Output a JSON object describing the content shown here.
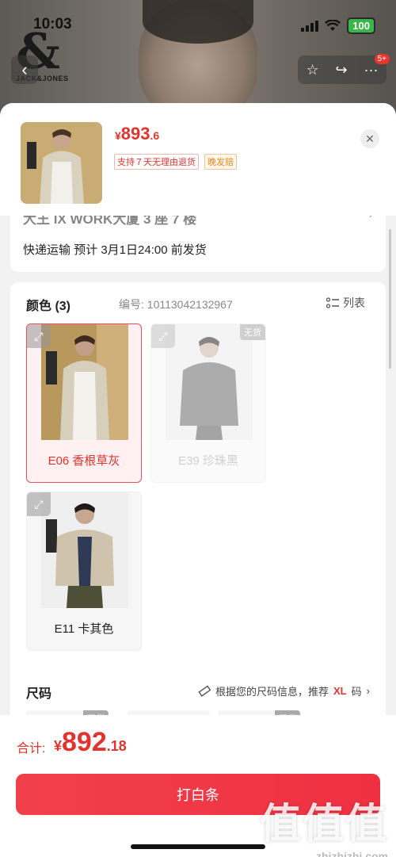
{
  "status_bar": {
    "time": "10:03",
    "battery": "100"
  },
  "brand": {
    "mark": "&",
    "name": "JACK&JONES"
  },
  "nav": {
    "badge": "5+"
  },
  "sheet": {
    "price": {
      "currency": "¥",
      "integer": "893",
      "decimal": ".6"
    },
    "tag_return": "支持７天无理由退货",
    "tag_late": "晚发赔"
  },
  "shipping": {
    "address": "大王 IX WORK大厦 3 座 7 楼",
    "info": "快递运输 预计 3月1日24:00 前发货"
  },
  "color_section": {
    "title": "颜色 (3)",
    "code": "编号: 10113042132967",
    "list_toggle": "列表",
    "variants": [
      {
        "label": "E06 香根草灰",
        "state": "selected",
        "sold_out": ""
      },
      {
        "label": "E39 珍珠黑",
        "state": "sold-out",
        "sold_out": "无货"
      },
      {
        "label": "E11 卡其色",
        "state": "available",
        "sold_out": ""
      }
    ]
  },
  "size_section": {
    "title": "尺码",
    "rec_prefix": "根据您的尺码信息，推荐",
    "rec_size": "XL",
    "rec_suffix": "码",
    "chips": [
      {
        "sold_out": "无货"
      },
      {
        "sold_out": ""
      },
      {
        "sold_out": "无货"
      }
    ]
  },
  "bottom": {
    "total_label": "合计:",
    "total": {
      "currency": "¥",
      "integer": "892",
      "decimal": ".18"
    },
    "buy_button": "打白条"
  },
  "watermark": {
    "main": "值值值",
    "sub": "zhizhizhi.com"
  },
  "colors": {
    "accent": "#e3332c",
    "button": "#f0384a"
  }
}
